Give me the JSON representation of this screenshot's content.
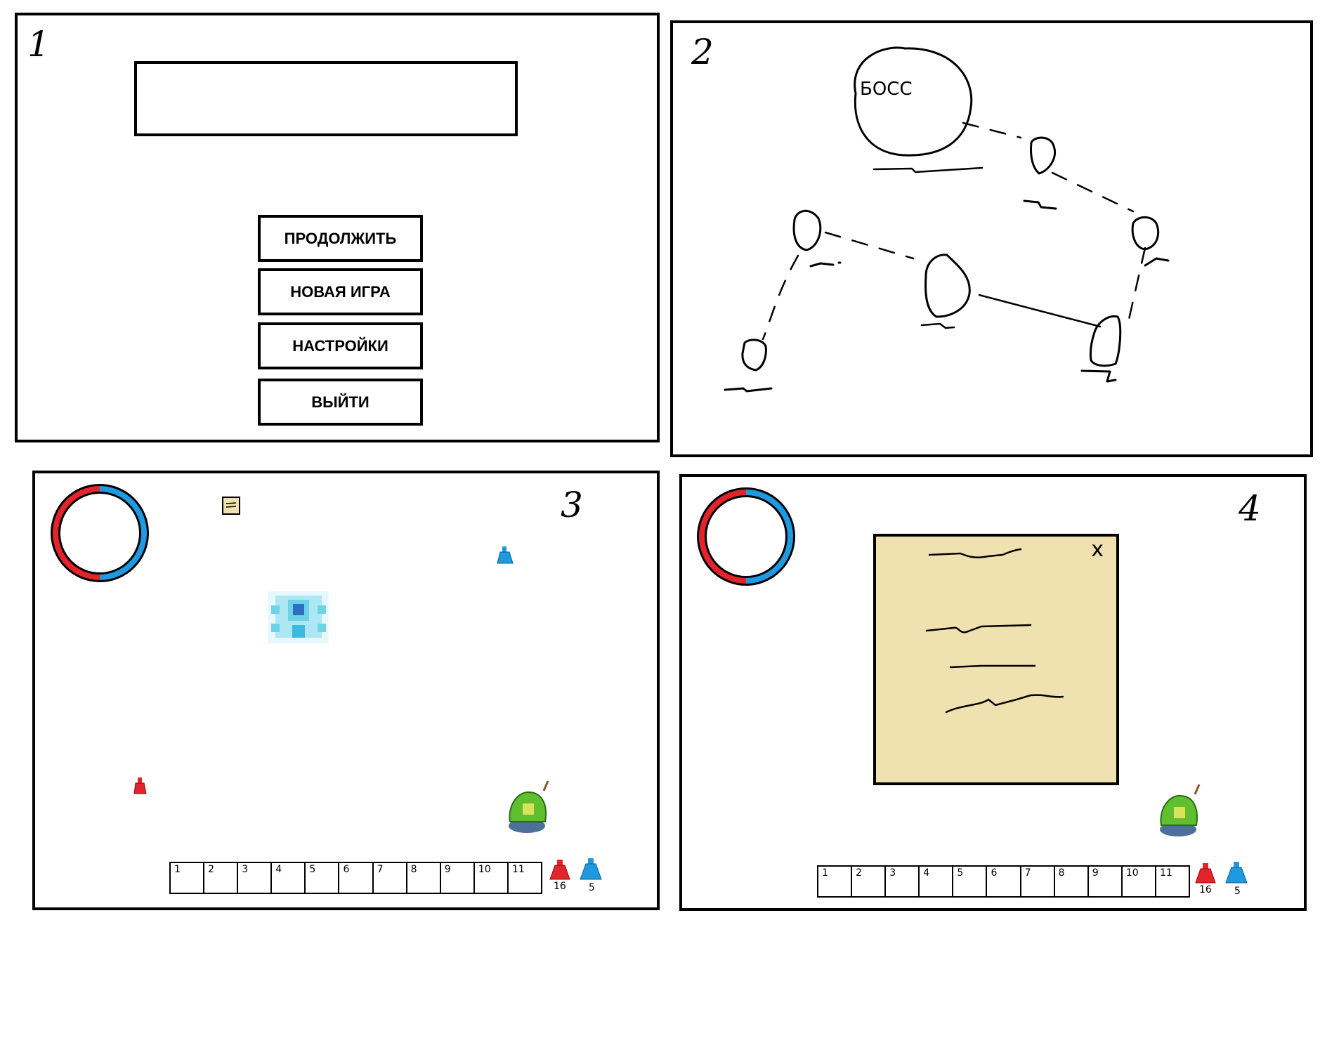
{
  "panel1": {
    "number": "1",
    "menu": {
      "continue_label": "ПРОДОЛЖИТЬ",
      "new_game_label": "НОВАЯ ИГРА",
      "settings_label": "НАСТРОЙКИ",
      "exit_label": "ВЫЙТИ"
    }
  },
  "panel2": {
    "number": "2",
    "boss_label": "БОСС"
  },
  "panel3": {
    "number": "3",
    "hotbar": [
      "1",
      "2",
      "3",
      "4",
      "5",
      "6",
      "7",
      "8",
      "9",
      "10",
      "11"
    ],
    "health_potions": "16",
    "mana_potions": "5"
  },
  "panel4": {
    "number": "4",
    "close_label": "x",
    "hotbar": [
      "1",
      "2",
      "3",
      "4",
      "5",
      "6",
      "7",
      "8",
      "9",
      "10",
      "11"
    ],
    "health_potions": "16",
    "mana_potions": "5"
  },
  "colors": {
    "health": "#e3242b",
    "mana": "#1f9ae0",
    "scroll": "#efe1b0",
    "slime": "#5fbf2f",
    "spirit": "#6fd3e8"
  },
  "icons": [
    "health-mana-ring-icon",
    "note-icon",
    "blue-potion-icon",
    "red-potion-icon",
    "spirit-enemy-icon",
    "player-slime-icon",
    "close-icon"
  ]
}
